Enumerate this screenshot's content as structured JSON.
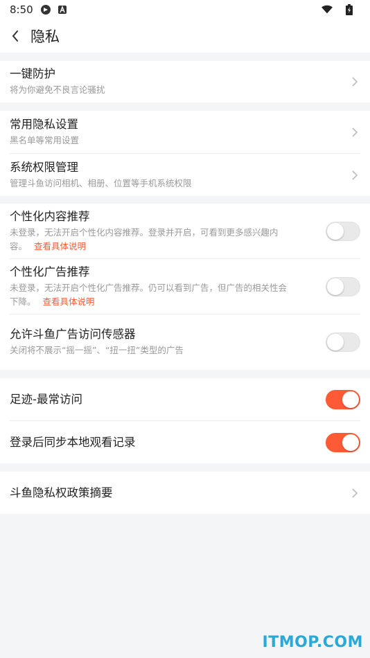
{
  "status_bar": {
    "time": "8:50"
  },
  "header": {
    "title": "隐私"
  },
  "sections": {
    "protection": {
      "title": "一键防护",
      "sub": "将为你避免不良言论骚扰"
    },
    "common": {
      "title": "常用隐私设置",
      "sub": "黑名单等常用设置"
    },
    "permissions": {
      "title": "系统权限管理",
      "sub": "管理斗鱼访问相机、相册、位置等手机系统权限"
    },
    "content_rec": {
      "title": "个性化内容推荐",
      "sub_line1": "未登录，无法开启个性化内容推荐。登录并开启，可看到更多感兴趣内",
      "sub_line2": "容。",
      "link": "查看具体说明",
      "enabled": false
    },
    "ad_rec": {
      "title": "个性化广告推荐",
      "sub_line1": "未登录，无法开启个性化广告推荐。仍可以看到广告，但广告的相关性会",
      "sub_line2": "下降。",
      "link": "查看具体说明",
      "enabled": false
    },
    "sensor": {
      "title": "允许斗鱼广告访问传感器",
      "sub": "关闭将不展示“摇一摇”、“扭一扭”类型的广告",
      "enabled": false
    },
    "footprint": {
      "title": "足迹-最常访问",
      "enabled": true
    },
    "sync": {
      "title": "登录后同步本地观看记录",
      "enabled": true
    },
    "policy": {
      "title": "斗鱼隐私权政策摘要"
    }
  },
  "colors": {
    "accent": "#ff5a36",
    "link": "#ff5a36",
    "background": "#f4f5f7"
  },
  "watermark": "ITMOP.COM"
}
